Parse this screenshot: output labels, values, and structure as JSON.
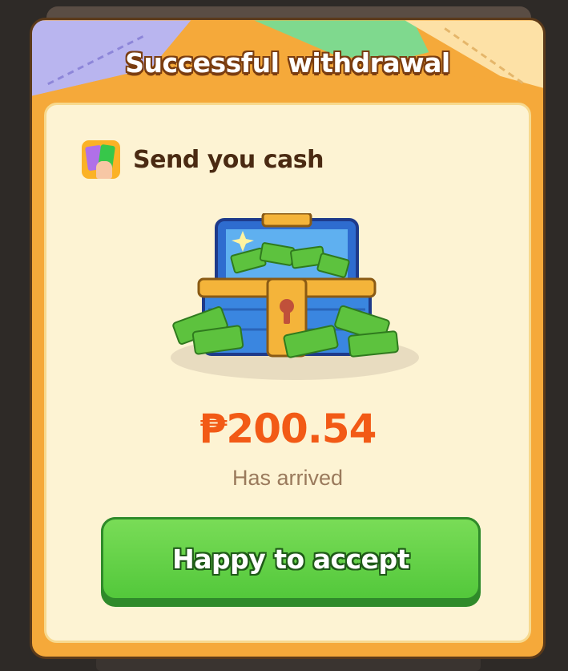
{
  "dialog": {
    "title": "Successful withdrawal",
    "send_label": "Send you cash",
    "amount": "₱200.54",
    "status": "Has arrived",
    "accept_label": "Happy to accept"
  },
  "icons": {
    "app": "cash-app-icon",
    "illustration": "treasure-chest-cash-icon"
  },
  "colors": {
    "frame": "#f5a93a",
    "body": "#fdf3d3",
    "amount": "#f25a16",
    "button": "#5ccd3f",
    "title_outline": "#7a3d10"
  }
}
